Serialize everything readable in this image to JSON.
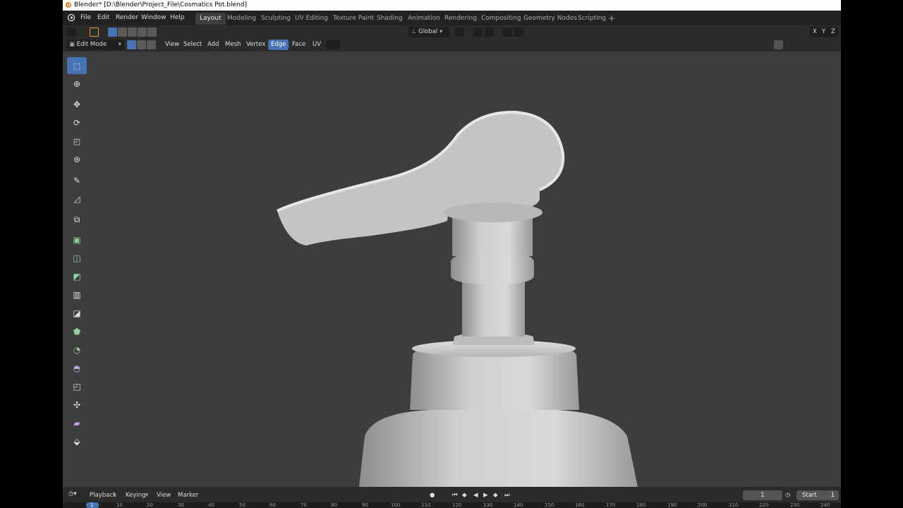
{
  "title_bar": {
    "title": "Blender* [D:\\Blender\\Project_File\\Cosmatics Pot.blend]"
  },
  "menu": [
    "File",
    "Edit",
    "Render",
    "Window",
    "Help"
  ],
  "workspace_tabs": [
    "Layout",
    "Modeling",
    "Sculpting",
    "UV Editing",
    "Texture Paint",
    "Shading",
    "Animation",
    "Rendering",
    "Compositing",
    "Geometry Nodes",
    "Scripting"
  ],
  "active_workspace": "Layout",
  "header": {
    "transform_orientation": "Global",
    "axis_x": "X",
    "axis_y": "Y",
    "axis_z": "Z"
  },
  "editor_header": {
    "mode": "Edit Mode",
    "menus": [
      "View",
      "Select",
      "Add",
      "Mesh",
      "Vertex",
      "Edge",
      "Face",
      "UV"
    ],
    "active_menu": "Edge"
  },
  "tools": [
    "select-box",
    "cursor",
    "move",
    "rotate",
    "scale",
    "transform",
    "annotate",
    "measure",
    "add-cube",
    "extrude-region",
    "inset-faces",
    "bevel",
    "loop-cut",
    "knife",
    "poly-build",
    "spin",
    "smooth",
    "edge-slide",
    "shrink-fatten",
    "shear",
    "rip-region"
  ],
  "timeline": {
    "playback": "Playback",
    "keying": "Keying",
    "view": "View",
    "marker": "Marker",
    "current_frame": "1",
    "start_label": "Start",
    "start_value": "1",
    "ruler_ticks": [
      "1",
      "10",
      "20",
      "30",
      "40",
      "50",
      "60",
      "70",
      "80",
      "90",
      "100",
      "110",
      "120",
      "130",
      "140",
      "150",
      "160",
      "170",
      "180",
      "190",
      "200",
      "210",
      "220",
      "230",
      "240"
    ]
  },
  "colors": {
    "accent": "#4772b3",
    "viewport_bg": "#3d3d3d",
    "header_bg": "#2b2b2b",
    "mesh": "#c9c9c9"
  }
}
